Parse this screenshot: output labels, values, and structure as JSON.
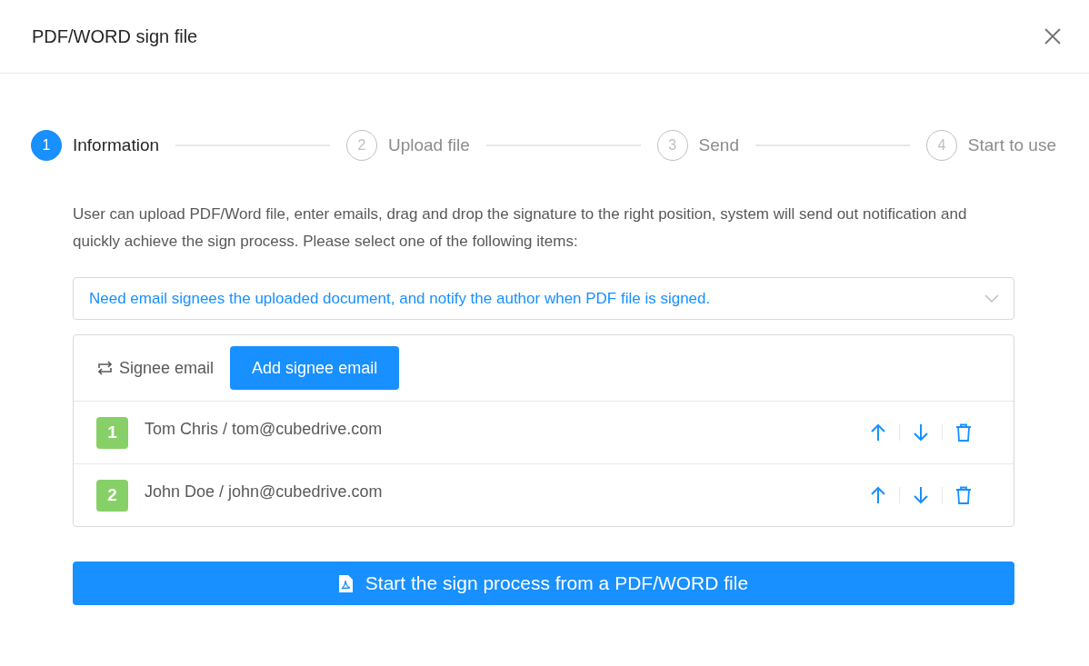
{
  "window": {
    "title": "PDF/WORD sign file"
  },
  "steps": [
    {
      "number": "1",
      "label": "Information",
      "selected": true
    },
    {
      "number": "2",
      "label": "Upload file",
      "selected": false
    },
    {
      "number": "3",
      "label": "Send",
      "selected": false
    },
    {
      "number": "4",
      "label": "Start to use",
      "selected": false
    }
  ],
  "description": "User can upload PDF/Word file, enter emails, drag and drop the signature to the right position, system will send out notification and quickly achieve the sign process. Please select one of the following items:",
  "select": {
    "value": "Need email signees the uploaded document, and notify the author when PDF file is signed."
  },
  "signees": {
    "label": "Signee email",
    "add_button": "Add signee email",
    "rows": [
      {
        "number": "1",
        "text": "Tom Chris / tom@cubedrive.com"
      },
      {
        "number": "2",
        "text": "John Doe / john@cubedrive.com"
      }
    ]
  },
  "start_button": "Start the sign process from a PDF/WORD file"
}
